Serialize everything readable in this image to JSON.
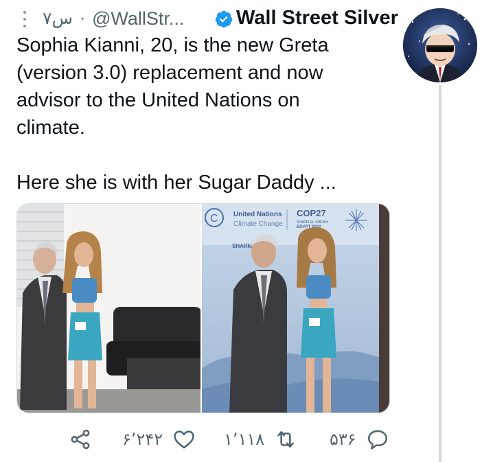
{
  "tweet": {
    "time": "۷س",
    "separator": "·",
    "handle": "@WallStr...",
    "author_name": "Wall Street Silver",
    "text_lines": [
      "Sophia Kianni, 20, is the new Greta",
      "(version 3.0) replacement and now",
      "advisor to the United Nations on",
      "climate.",
      "",
      "Here she is with her Sugar Daddy ..."
    ],
    "media": {
      "right_banner": {
        "un_line1": "United Nations",
        "un_line2": "Climate Change",
        "cop_title": "COP27",
        "cop_line1": "SHARM EL-SHEIKH",
        "cop_line2": "EGYPT 2022",
        "sharm": "SHARM E"
      }
    },
    "actions": {
      "replies": "۵۳۶",
      "retweets": "۱٬۱۱۸",
      "likes": "۶٬۲۴۲"
    }
  },
  "colors": {
    "text": "#0f1419",
    "muted": "#536471",
    "verified": "#1d9bf0",
    "border": "#cfd9de"
  }
}
